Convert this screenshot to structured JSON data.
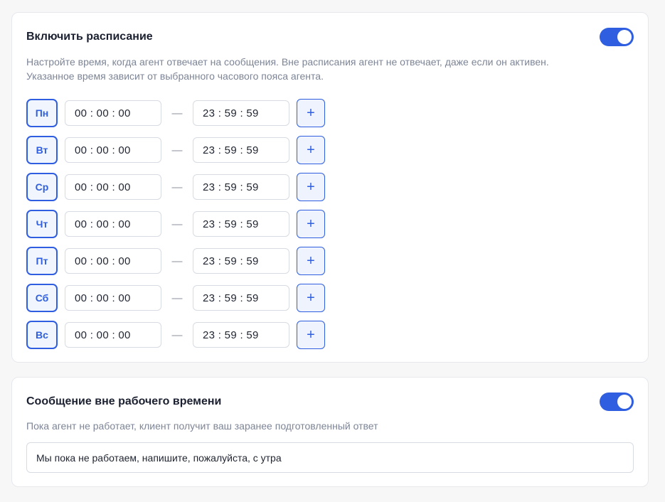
{
  "schedule": {
    "title": "Включить расписание",
    "enabled": true,
    "description_line1": "Настройте время, когда агент отвечает на сообщения. Вне расписания агент не отвечает, даже если он активен.",
    "description_line2": "Указанное время зависит от выбранного часового пояса агента.",
    "dash": "—",
    "add_label": "+",
    "days": [
      {
        "label": "Пн",
        "start": "00 : 00 : 00",
        "end": "23 : 59 : 59"
      },
      {
        "label": "Вт",
        "start": "00 : 00 : 00",
        "end": "23 : 59 : 59"
      },
      {
        "label": "Ср",
        "start": "00 : 00 : 00",
        "end": "23 : 59 : 59"
      },
      {
        "label": "Чт",
        "start": "00 : 00 : 00",
        "end": "23 : 59 : 59"
      },
      {
        "label": "Пт",
        "start": "00 : 00 : 00",
        "end": "23 : 59 : 59"
      },
      {
        "label": "Сб",
        "start": "00 : 00 : 00",
        "end": "23 : 59 : 59"
      },
      {
        "label": "Вс",
        "start": "00 : 00 : 00",
        "end": "23 : 59 : 59"
      }
    ]
  },
  "offhours": {
    "title": "Сообщение вне рабочего времени",
    "enabled": true,
    "description": "Пока агент не работает, клиент получит ваш заранее подготовленный ответ",
    "message": "Мы пока не работаем, напишите, пожалуйста, с утра"
  },
  "colors": {
    "accent": "#2f5fe0",
    "muted_text": "#7d8596",
    "border": "#d7dbe2"
  }
}
